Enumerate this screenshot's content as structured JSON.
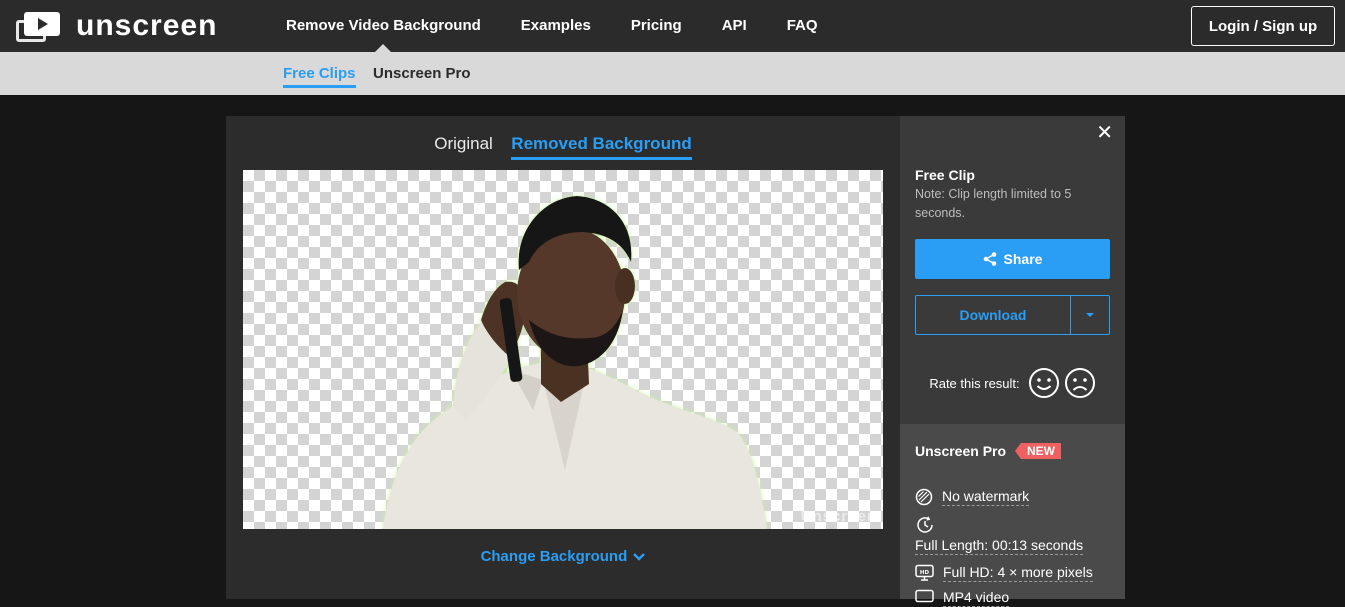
{
  "header": {
    "brand": "unscreen",
    "nav": [
      "Remove Video Background",
      "Examples",
      "Pricing",
      "API",
      "FAQ"
    ],
    "login_label": "Login / Sign up"
  },
  "subnav": {
    "items": [
      "Free Clips",
      "Unscreen Pro"
    ]
  },
  "editor": {
    "tabs": [
      "Original",
      "Removed Background"
    ],
    "watermark": "Unscreen",
    "change_background": "Change Background"
  },
  "sidebar": {
    "title": "Free Clip",
    "note": "Note: Clip length limited to 5 seconds.",
    "share_label": "Share",
    "download_label": "Download",
    "rate_label": "Rate this result:",
    "pro": {
      "title": "Unscreen Pro",
      "badge": "NEW",
      "features": [
        "No watermark",
        "Full Length: 00:13 seconds",
        "Full HD: 4 × more pixels",
        "MP4 video"
      ]
    }
  },
  "colors": {
    "accent": "#2a9df4",
    "badge": "#f06060",
    "topbar": "#2b2b2b"
  },
  "icons": [
    "play-logo-icon",
    "close-icon",
    "share-icon",
    "chevron-down-icon",
    "smile-icon",
    "frown-icon",
    "no-watermark-icon",
    "clock-icon",
    "hd-icon",
    "video-icon"
  ]
}
